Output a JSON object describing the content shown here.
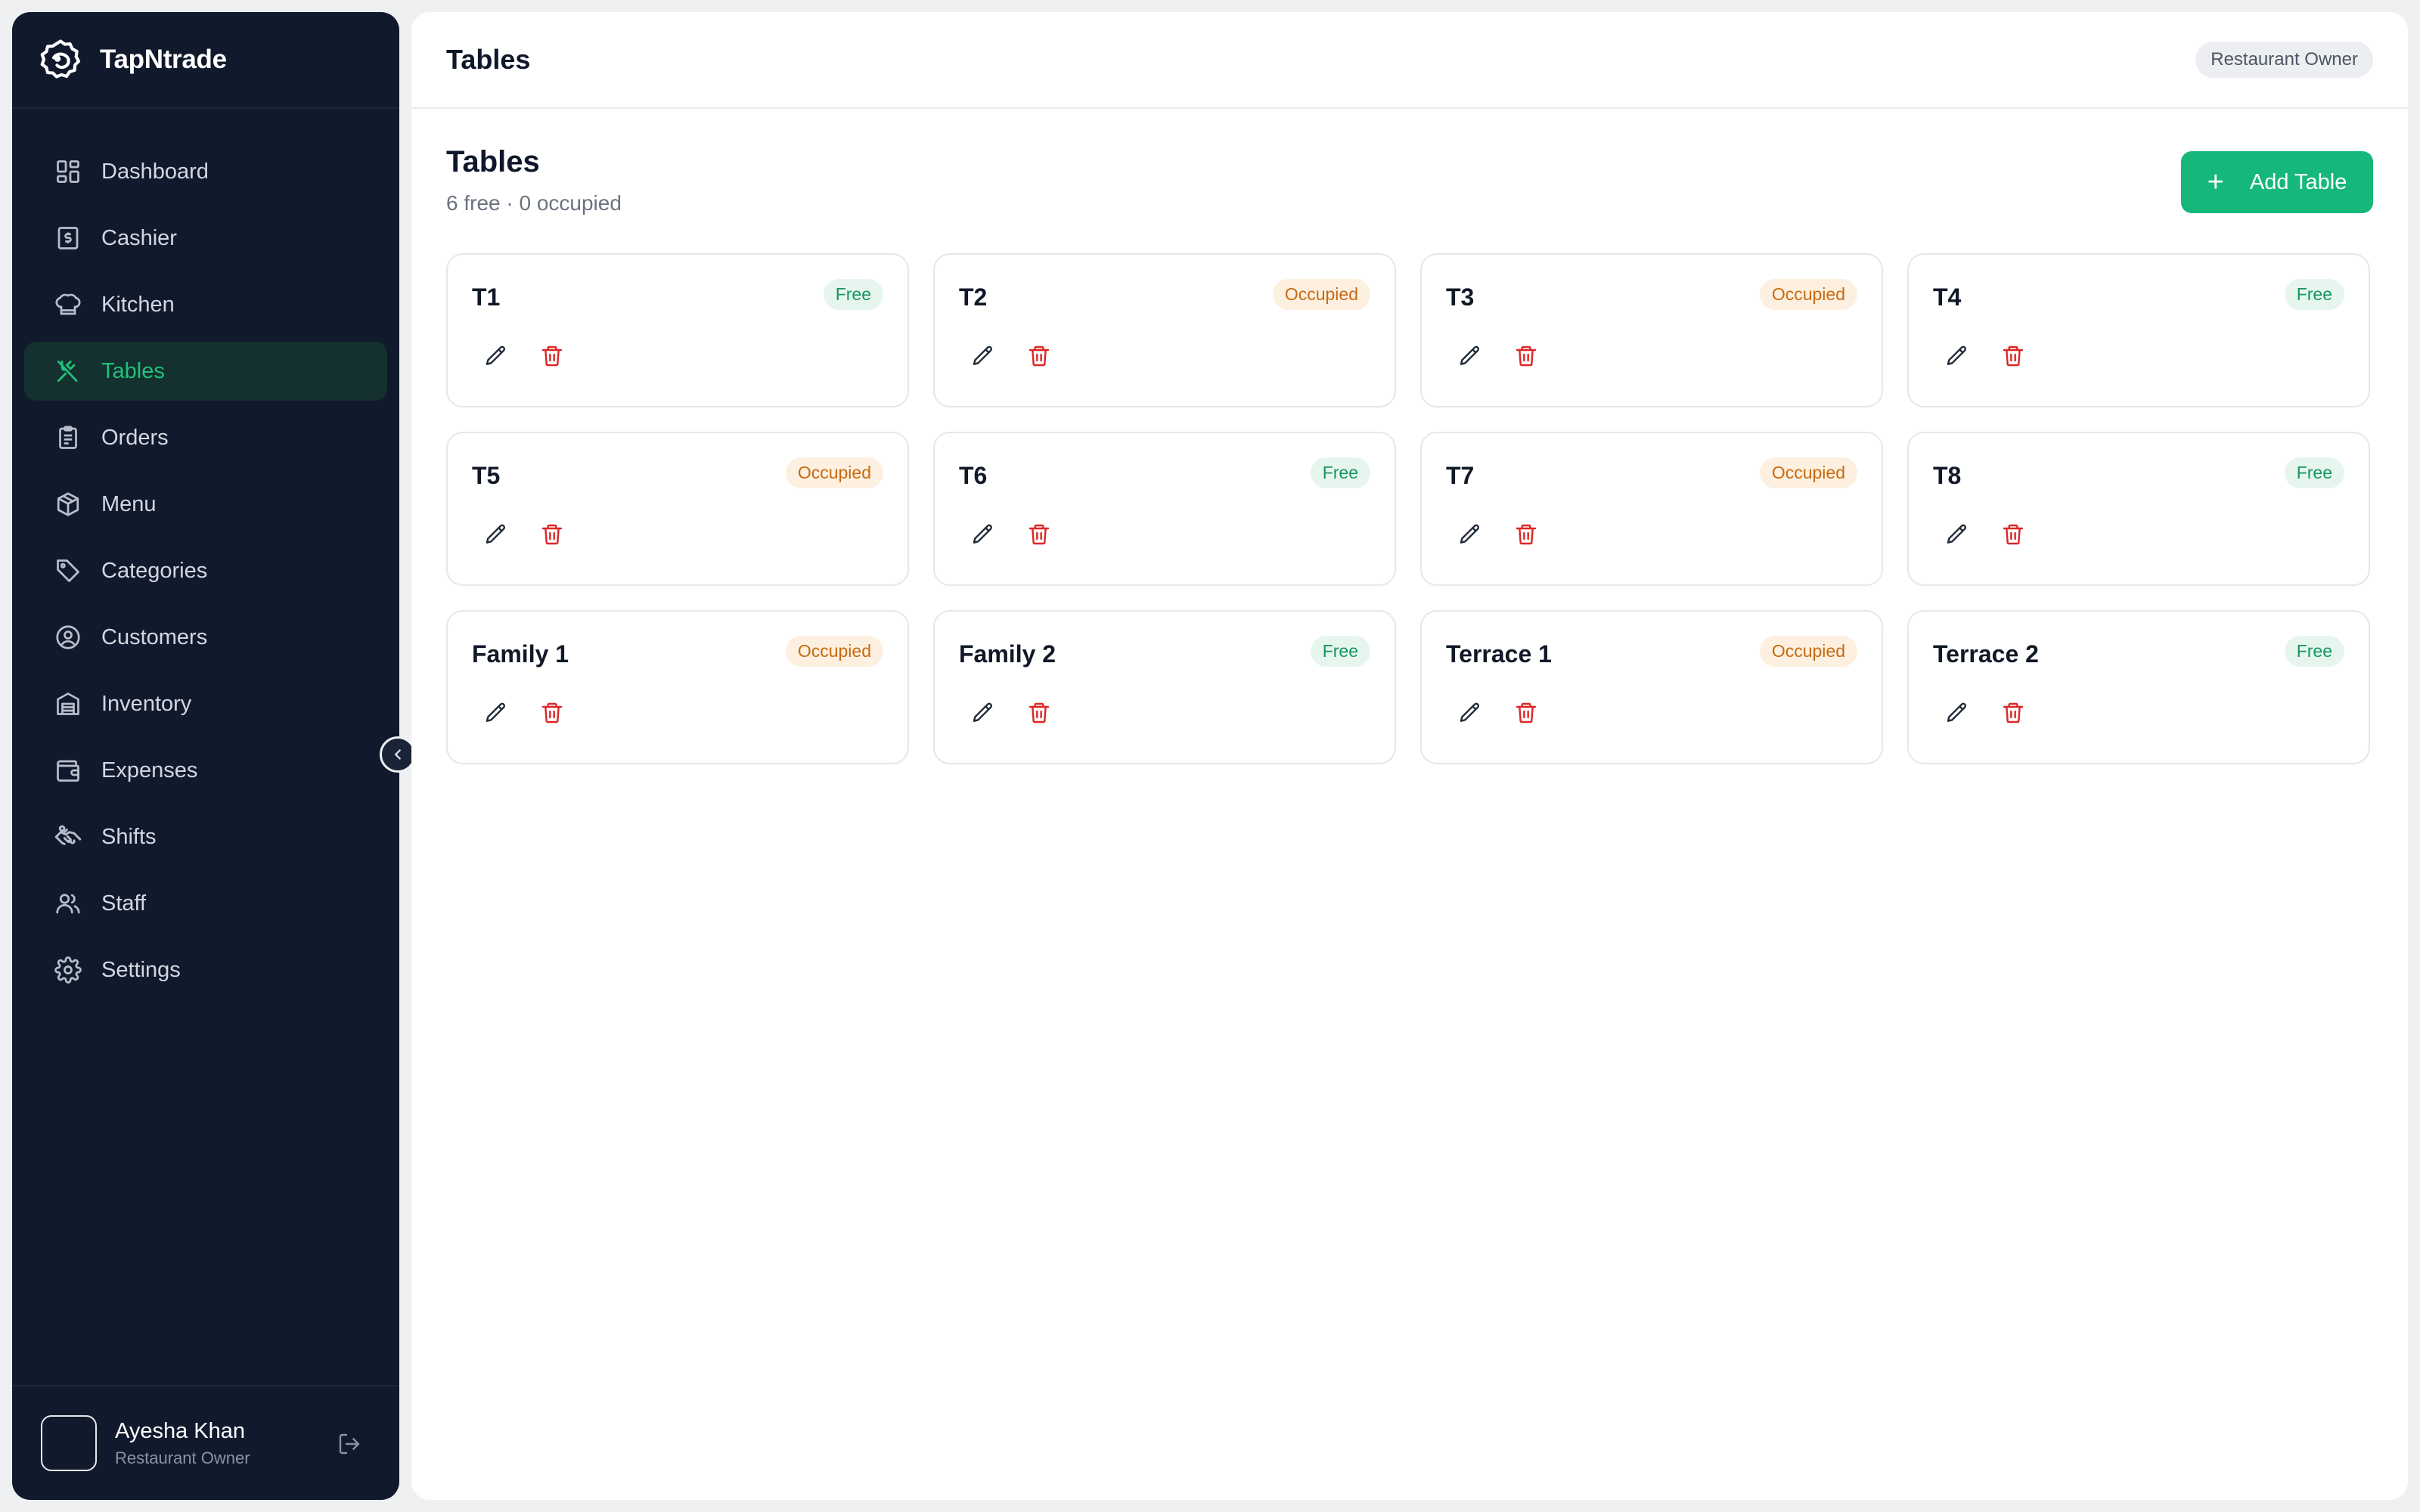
{
  "brand": {
    "name": "TapNtrade",
    "logo_icon": "lion-logo-icon"
  },
  "sidebar": {
    "items": [
      {
        "label": "Dashboard",
        "icon": "dashboard-icon"
      },
      {
        "label": "Cashier",
        "icon": "cashier-icon"
      },
      {
        "label": "Kitchen",
        "icon": "chef-hat-icon"
      },
      {
        "label": "Tables",
        "icon": "utensils-icon",
        "active": true
      },
      {
        "label": "Orders",
        "icon": "clipboard-icon"
      },
      {
        "label": "Menu",
        "icon": "box-icon"
      },
      {
        "label": "Categories",
        "icon": "tag-icon"
      },
      {
        "label": "Customers",
        "icon": "user-circle-icon"
      },
      {
        "label": "Inventory",
        "icon": "warehouse-icon"
      },
      {
        "label": "Expenses",
        "icon": "wallet-icon"
      },
      {
        "label": "Shifts",
        "icon": "handshake-icon"
      },
      {
        "label": "Staff",
        "icon": "users-icon"
      },
      {
        "label": "Settings",
        "icon": "gear-icon"
      }
    ],
    "user": {
      "name": "Ayesha Khan",
      "role": "Restaurant Owner"
    }
  },
  "topbar": {
    "title": "Tables",
    "role_badge": "Restaurant Owner"
  },
  "page": {
    "title": "Tables",
    "subtitle": "6 free · 0 occupied",
    "add_button_label": "Add Table"
  },
  "tables": [
    {
      "name": "T1",
      "status": "Free"
    },
    {
      "name": "T2",
      "status": "Occupied"
    },
    {
      "name": "T3",
      "status": "Occupied"
    },
    {
      "name": "T4",
      "status": "Free"
    },
    {
      "name": "T5",
      "status": "Occupied"
    },
    {
      "name": "T6",
      "status": "Free"
    },
    {
      "name": "T7",
      "status": "Occupied"
    },
    {
      "name": "T8",
      "status": "Free"
    },
    {
      "name": "Family 1",
      "status": "Occupied"
    },
    {
      "name": "Family 2",
      "status": "Free"
    },
    {
      "name": "Terrace 1",
      "status": "Occupied"
    },
    {
      "name": "Terrace 2",
      "status": "Free"
    }
  ],
  "colors": {
    "sidebar_bg": "#111a2c",
    "accent": "#16b77a",
    "free_text": "#16955f",
    "occupied_text": "#c76a10",
    "delete": "#dc2626"
  }
}
